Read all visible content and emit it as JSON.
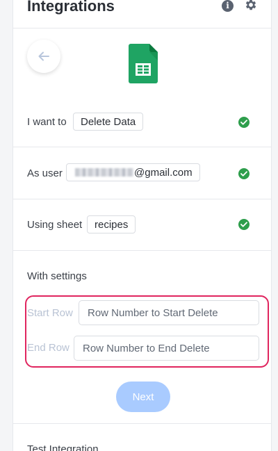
{
  "header": {
    "title": "Integrations",
    "info_icon": "info-icon",
    "settings_icon": "gear-icon"
  },
  "hero": {
    "back_icon": "arrow-left-icon",
    "logo_icon": "google-sheets-icon",
    "logo_color": "#1fa463"
  },
  "rows": {
    "action": {
      "label": "I want to",
      "value": "Delete Data",
      "status": "complete"
    },
    "user": {
      "label": "As user",
      "value_suffix": "@gmail.com",
      "status": "complete"
    },
    "sheet": {
      "label": "Using sheet",
      "value": "recipes",
      "status": "complete"
    }
  },
  "settings": {
    "title": "With settings",
    "start_row": {
      "label": "Start Row",
      "placeholder": "Row Number to Start Delete",
      "value": ""
    },
    "end_row": {
      "label": "End Row",
      "placeholder": "Row Number to End Delete",
      "value": ""
    },
    "highlight_color": "#e0245e"
  },
  "next_button": {
    "label": "Next",
    "color": "#a9cbff"
  },
  "test_section": {
    "title": "Test Integration"
  },
  "colors": {
    "check_green": "#2e9e4c"
  }
}
